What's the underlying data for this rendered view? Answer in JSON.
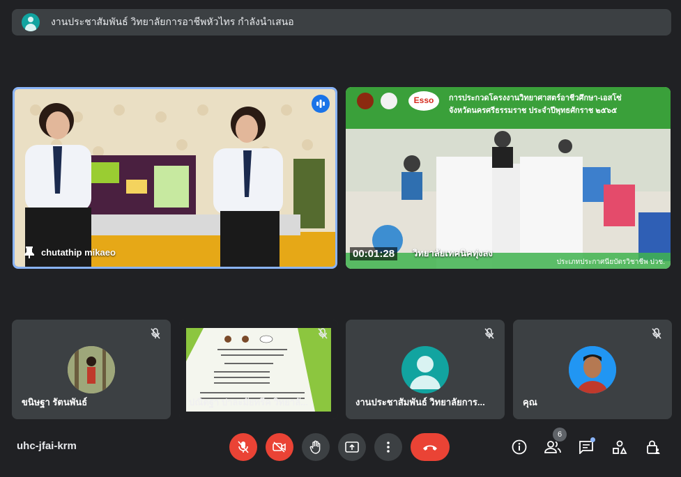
{
  "banner": {
    "text": "งานประชาสัมพันธ์ วิทยาลัยการอาชีพหัวไทร กำลังนำเสนอ"
  },
  "main_tiles": [
    {
      "name": "chutathip mikaeo"
    },
    {
      "name": "วิทยาลัยเทคนิคทุ่งสง",
      "overlay_title_1": "การประกวดโครงงานวิทยาศาสตร์อาชีวศึกษา-เอสโซ่",
      "overlay_title_2": "จังหวัดนครศรีธรรมราช ประจำปีพุทธศักราช ๒๕๖๕",
      "overlay_timer": "00:01:28",
      "overlay_footer": "ประเภทประกาศนียบัตรวิชาชีพ ปวช.",
      "logo_text": "Esso"
    }
  ],
  "small_tiles": [
    {
      "name": "ขนิษฐา รัตนพันธ์"
    },
    {
      "name": "ปณิตฐา ปาละมัยทรีค วิทยาลั..."
    },
    {
      "name": "งานประชาสัมพันธ์ วิทยาลัยการ..."
    },
    {
      "name": "คุณ"
    }
  ],
  "meeting": {
    "code": "uhc-jfai-krm",
    "participant_count": "6"
  },
  "colors": {
    "bg": "#202124",
    "tile": "#3c4043",
    "red": "#ea4335",
    "accent": "#8ab4f8"
  }
}
